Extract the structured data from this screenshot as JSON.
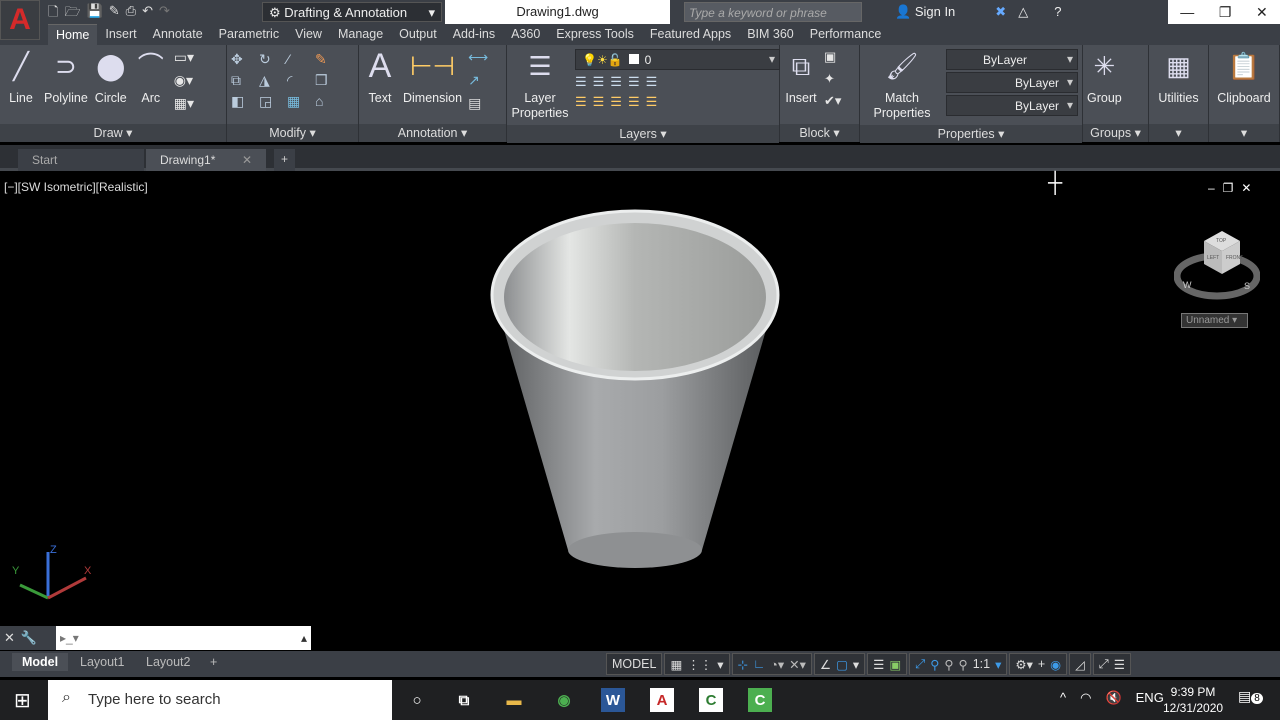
{
  "app": {
    "logo": "A",
    "workspace": "Drafting & Annotation",
    "document_title": "Drawing1.dwg",
    "search_placeholder": "Type a keyword or phrase",
    "sign_in": "Sign In"
  },
  "ribbon_tabs": [
    "Home",
    "Insert",
    "Annotate",
    "Parametric",
    "View",
    "Manage",
    "Output",
    "Add-ins",
    "A360",
    "Express Tools",
    "Featured Apps",
    "BIM 360",
    "Performance"
  ],
  "panels": {
    "draw": {
      "title": "Draw",
      "tools": [
        "Line",
        "Polyline",
        "Circle",
        "Arc"
      ]
    },
    "modify": {
      "title": "Modify"
    },
    "annotation": {
      "title": "Annotation",
      "tools": [
        "Text",
        "Dimension"
      ]
    },
    "layers": {
      "title": "Layers",
      "tool": "Layer Properties",
      "layer_value": "0"
    },
    "block": {
      "title": "Block",
      "tool": "Insert"
    },
    "properties": {
      "title": "Properties",
      "tool": "Match Properties",
      "color": "ByLayer",
      "linetype": "ByLayer",
      "lineweight": "ByLayer"
    },
    "groups": {
      "title": "Groups",
      "tool": "Group"
    },
    "utilities": {
      "title": "Utilities"
    },
    "clipboard": {
      "title": "Clipboard"
    }
  },
  "doc_tabs": [
    "Start",
    "Drawing1*"
  ],
  "viewport": {
    "label": "[−][SW Isometric][Realistic]",
    "viewcube": {
      "top": "TOP",
      "left": "LEFT",
      "front": "FRONT",
      "w": "W",
      "s": "S"
    },
    "ucs_name": "Unnamed",
    "axes": {
      "x": "X",
      "y": "Y",
      "z": "Z"
    }
  },
  "layout_tabs": [
    "Model",
    "Layout1",
    "Layout2"
  ],
  "status_bar": {
    "model": "MODEL",
    "scale": "1:1"
  },
  "taskbar": {
    "search_placeholder": "Type here to search",
    "language": "ENG",
    "time": "9:39 PM",
    "date": "12/31/2020",
    "notifications": "8"
  }
}
